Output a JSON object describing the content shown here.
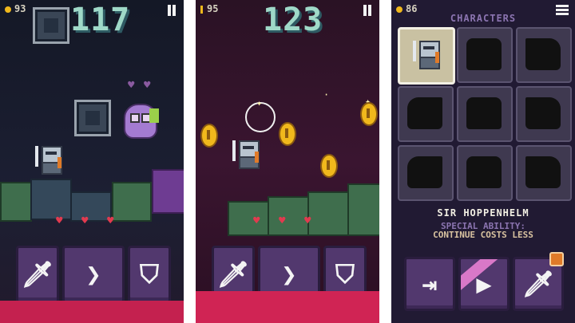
{
  "screen1": {
    "coins": "93",
    "score": "117",
    "buttons": [
      {
        "icon": "sword-icon",
        "glyph": "🗡"
      },
      {
        "icon": "chevron-right-icon",
        "glyph": "❯"
      },
      {
        "icon": "shield-icon",
        "glyph": "⛉"
      }
    ]
  },
  "screen2": {
    "coins": "95",
    "score": "123",
    "buttons": [
      {
        "icon": "sword-icon",
        "glyph": "🗡"
      },
      {
        "icon": "chevron-right-icon",
        "glyph": "❯"
      },
      {
        "icon": "shield-icon",
        "glyph": "⛉"
      }
    ]
  },
  "screen3": {
    "coins": "86",
    "title": "CHARACTERS",
    "character_name": "SIR HOPPENHELM",
    "ability_label": "SPECIAL ABILITY:",
    "ability_text": "CONTINUE COSTS LESS",
    "buttons": [
      {
        "icon": "exit-icon",
        "glyph": "⇥"
      },
      {
        "icon": "play-icon",
        "glyph": "▶"
      },
      {
        "icon": "equipment-icon",
        "glyph": "🗡"
      }
    ]
  },
  "colors": {
    "button": "#52386e",
    "accent_coin": "#f0b81c",
    "score": "#9fd9c8",
    "lava": "#c4214f"
  }
}
